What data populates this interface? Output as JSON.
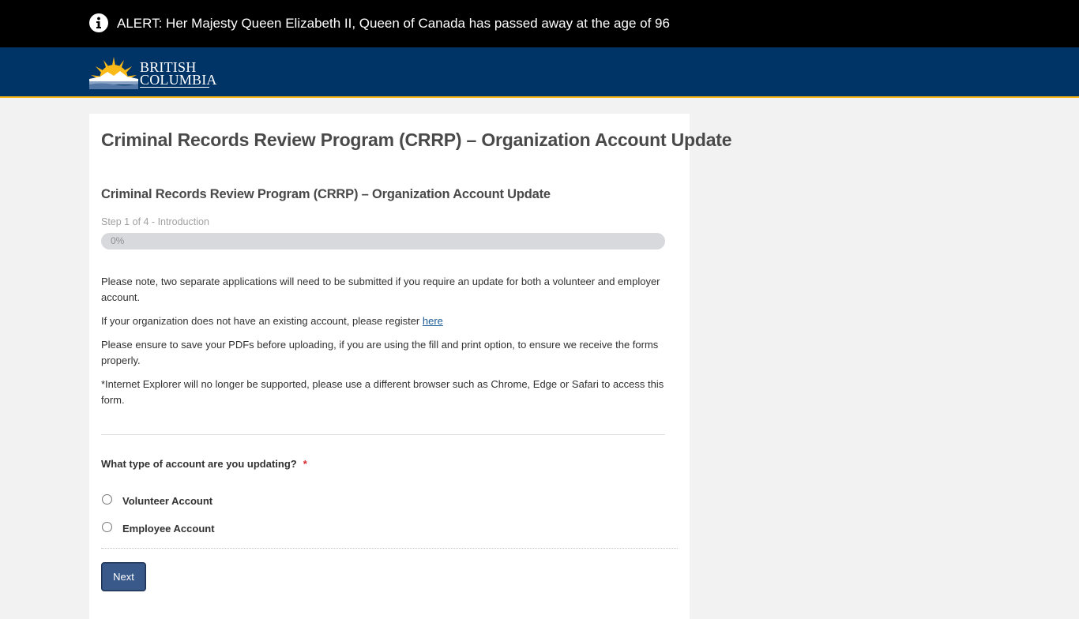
{
  "alert": {
    "icon": "info-icon",
    "text": "ALERT: Her Majesty Queen Elizabeth II, Queen of Canada has passed away at the age of 96"
  },
  "header": {
    "logo": {
      "line1": "BRITISH",
      "line2": "COLUMBIA",
      "icon": "bc-sun-logo"
    },
    "colors": {
      "background": "#003366",
      "accent": "#fcba19"
    }
  },
  "page": {
    "title": "Criminal Records Review Program (CRRP) – Organization Account Update"
  },
  "form": {
    "title": "Criminal Records Review Program (CRRP) – Organization Account Update",
    "step_label": "Step 1 of 4 - Introduction",
    "progress": {
      "percent": 0,
      "text": "0%"
    },
    "paragraphs": {
      "p1": "Please note, two separate applications will need to be submitted if you require an update for both a volunteer and employer account.",
      "p2_prefix": "If your organization does not have an existing account, please register ",
      "p2_link": "here",
      "p3": "Please ensure to save your PDFs before uploading, if you are using the fill and print option, to ensure we receive the forms properly.",
      "p4": "*Internet Explorer will no longer be supported, please use a different browser such as Chrome, Edge or Safari to access this form."
    },
    "question": {
      "label": "What type of account are you updating?",
      "required_marker": "*",
      "options": [
        {
          "label": "Volunteer Account",
          "selected": false
        },
        {
          "label": "Employee Account",
          "selected": false
        }
      ]
    },
    "next_button": "Next"
  }
}
